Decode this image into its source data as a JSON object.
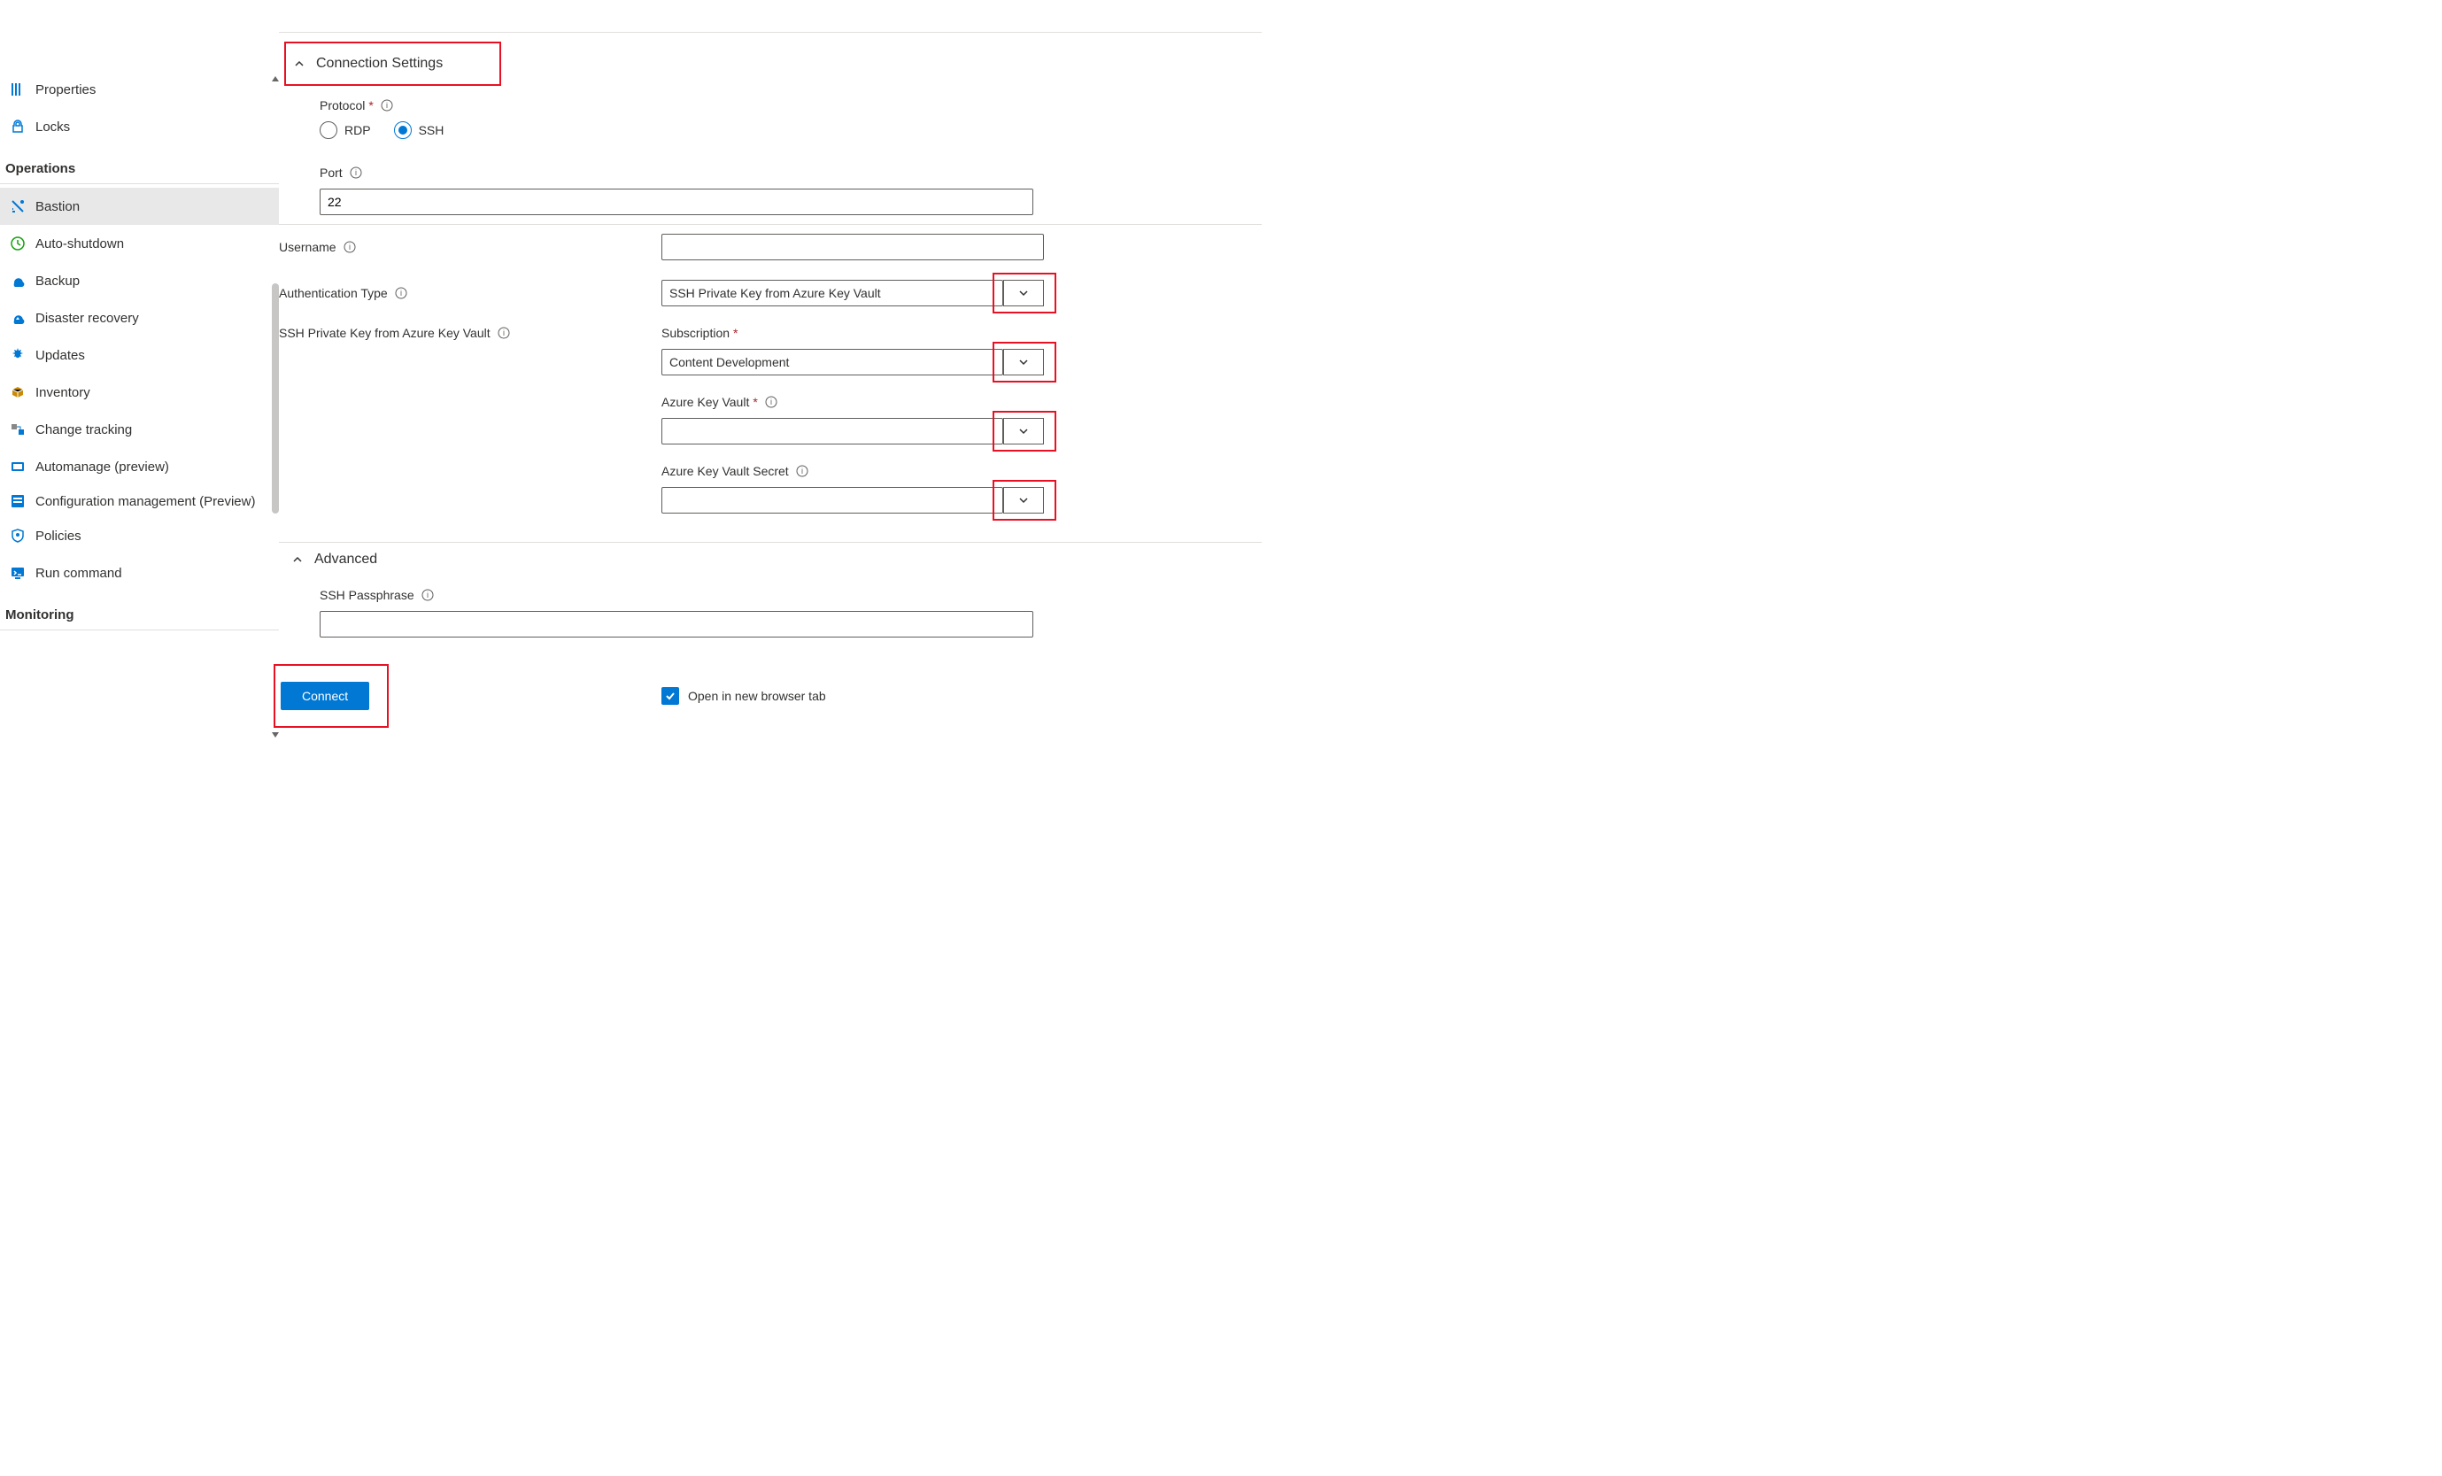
{
  "sidebar": {
    "settings_items": [
      {
        "icon": "properties",
        "label": "Properties"
      },
      {
        "icon": "lock",
        "label": "Locks"
      }
    ],
    "section_operations": "Operations",
    "operations_items": [
      {
        "icon": "bastion",
        "label": "Bastion",
        "selected": true
      },
      {
        "icon": "autoshutdown",
        "label": "Auto-shutdown"
      },
      {
        "icon": "backup",
        "label": "Backup"
      },
      {
        "icon": "dr",
        "label": "Disaster recovery"
      },
      {
        "icon": "updates",
        "label": "Updates"
      },
      {
        "icon": "inventory",
        "label": "Inventory"
      },
      {
        "icon": "changetracking",
        "label": "Change tracking"
      },
      {
        "icon": "automanage",
        "label": "Automanage (preview)"
      },
      {
        "icon": "config",
        "label": "Configuration management (Preview)"
      },
      {
        "icon": "policies",
        "label": "Policies"
      },
      {
        "icon": "runcmd",
        "label": "Run command"
      }
    ],
    "section_monitoring": "Monitoring"
  },
  "form": {
    "connection_settings_title": "Connection Settings",
    "protocol_label": "Protocol",
    "protocol_rdp": "RDP",
    "protocol_ssh": "SSH",
    "port_label": "Port",
    "port_value": "22",
    "username_label": "Username",
    "username_value": "",
    "auth_type_label": "Authentication Type",
    "auth_type_value": "SSH Private Key from Azure Key Vault",
    "keyvault_section_label": "SSH Private Key from Azure Key Vault",
    "subscription_label": "Subscription",
    "subscription_value": "Content Development",
    "akv_label": "Azure Key Vault",
    "akv_value": "",
    "akv_secret_label": "Azure Key Vault Secret",
    "akv_secret_value": "",
    "advanced_title": "Advanced",
    "ssh_passphrase_label": "SSH Passphrase",
    "ssh_passphrase_value": "",
    "connect_button": "Connect",
    "open_new_tab_label": "Open in new browser tab",
    "open_new_tab_checked": true
  }
}
